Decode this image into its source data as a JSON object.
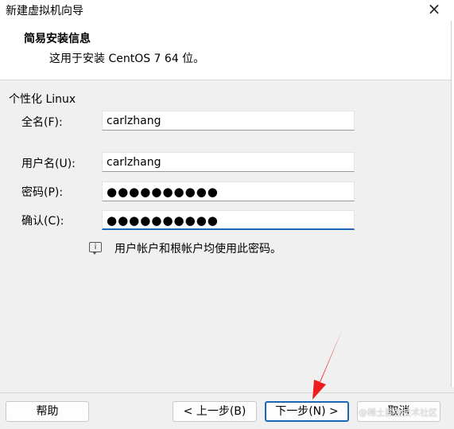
{
  "window": {
    "title": "新建虚拟机向导",
    "close_icon": "×"
  },
  "header": {
    "title": "简易安装信息",
    "subtitle": "这用于安装 CentOS 7 64 位。"
  },
  "group": {
    "label": "个性化 Linux"
  },
  "form": {
    "fullname_label": "全名(F):",
    "fullname_value": "carlzhang",
    "username_label": "用户名(U):",
    "username_value": "carlzhang",
    "password_label": "密码(P):",
    "password_value": "●●●●●●●●●●",
    "confirm_label": "确认(C):",
    "confirm_value": "●●●●●●●●●●"
  },
  "info": {
    "icon": "message-icon",
    "text": "用户帐户和根帐户均使用此密码。"
  },
  "buttons": {
    "help": "帮助",
    "back": "< 上一步(B)",
    "next": "下一步(N) >",
    "cancel": "取消"
  },
  "watermark": "@稀土掘金技术社区",
  "colors": {
    "accent": "#1a66b8",
    "annotation_arrow": "#ee1c1c"
  }
}
